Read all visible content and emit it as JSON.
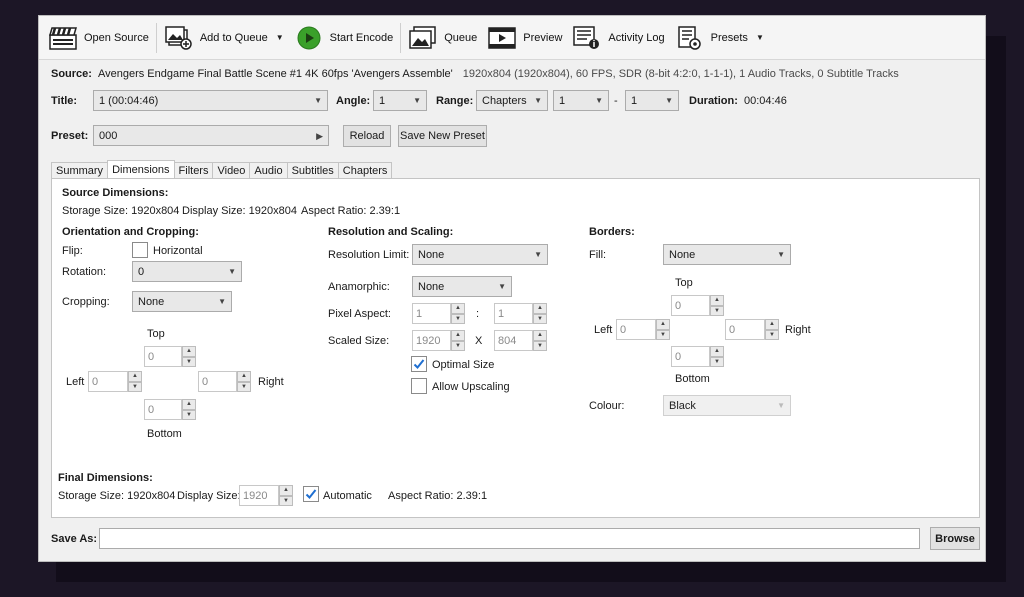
{
  "toolbar": {
    "open_source": "Open Source",
    "add_to_queue": "Add to Queue",
    "start_encode": "Start Encode",
    "queue": "Queue",
    "preview": "Preview",
    "activity_log": "Activity Log",
    "presets": "Presets"
  },
  "source": {
    "label": "Source:",
    "name": "Avengers Endgame Final Battle Scene #1 4K 60fps 'Avengers Assemble'",
    "info": "1920x804 (1920x804), 60 FPS, SDR (8-bit 4:2:0, 1-1-1), 1 Audio Tracks, 0 Subtitle Tracks"
  },
  "title_row": {
    "title_label": "Title:",
    "title_value": "1 (00:04:46)",
    "angle_label": "Angle:",
    "angle_value": "1",
    "range_label": "Range:",
    "range_type": "Chapters",
    "range_start": "1",
    "range_dash": "-",
    "range_end": "1",
    "duration_label": "Duration:",
    "duration_value": "00:04:46"
  },
  "preset": {
    "label": "Preset:",
    "value": "000",
    "reload": "Reload",
    "save_new": "Save New Preset"
  },
  "tabs": [
    "Summary",
    "Dimensions",
    "Filters",
    "Video",
    "Audio",
    "Subtitles",
    "Chapters"
  ],
  "dimensions": {
    "source_dims_title": "Source Dimensions:",
    "storage_size": "Storage Size: 1920x804",
    "display_size": "Display Size: 1920x804",
    "aspect_ratio": "Aspect Ratio: 2.39:1",
    "orientation_title": "Orientation and Cropping:",
    "flip_label": "Flip:",
    "flip_option": "Horizontal",
    "rotation_label": "Rotation:",
    "rotation_value": "0",
    "cropping_label": "Cropping:",
    "cropping_value": "None",
    "top_label": "Top",
    "left_label": "Left",
    "right_label": "Right",
    "bottom_label": "Bottom",
    "crop_top": "0",
    "crop_left": "0",
    "crop_right": "0",
    "crop_bottom": "0",
    "resolution_title": "Resolution and Scaling:",
    "res_limit_label": "Resolution Limit:",
    "res_limit_value": "None",
    "anamorphic_label": "Anamorphic:",
    "anamorphic_value": "None",
    "pixel_aspect_label": "Pixel Aspect:",
    "pixel_aspect_w": "1",
    "pixel_aspect_colon": ":",
    "pixel_aspect_h": "1",
    "scaled_size_label": "Scaled Size:",
    "scaled_w": "1920",
    "scaled_x": "X",
    "scaled_h": "804",
    "optimal_size": "Optimal Size",
    "allow_upscaling": "Allow Upscaling",
    "borders_title": "Borders:",
    "fill_label": "Fill:",
    "fill_value": "None",
    "border_top": "0",
    "border_left": "0",
    "border_right": "0",
    "border_bottom": "0",
    "colour_label": "Colour:",
    "colour_value": "Black",
    "final_title": "Final Dimensions:",
    "final_storage": "Storage Size: 1920x804",
    "final_display_label": "Display Size:",
    "final_display_value": "1920",
    "automatic": "Automatic",
    "final_aspect": "Aspect Ratio: 2.39:1"
  },
  "save_as": {
    "label": "Save As:",
    "value": "",
    "browse": "Browse"
  },
  "colors": {
    "accent_check": "#1f6fd1",
    "start_green": "#3aa02a",
    "background": "#1c1626"
  }
}
